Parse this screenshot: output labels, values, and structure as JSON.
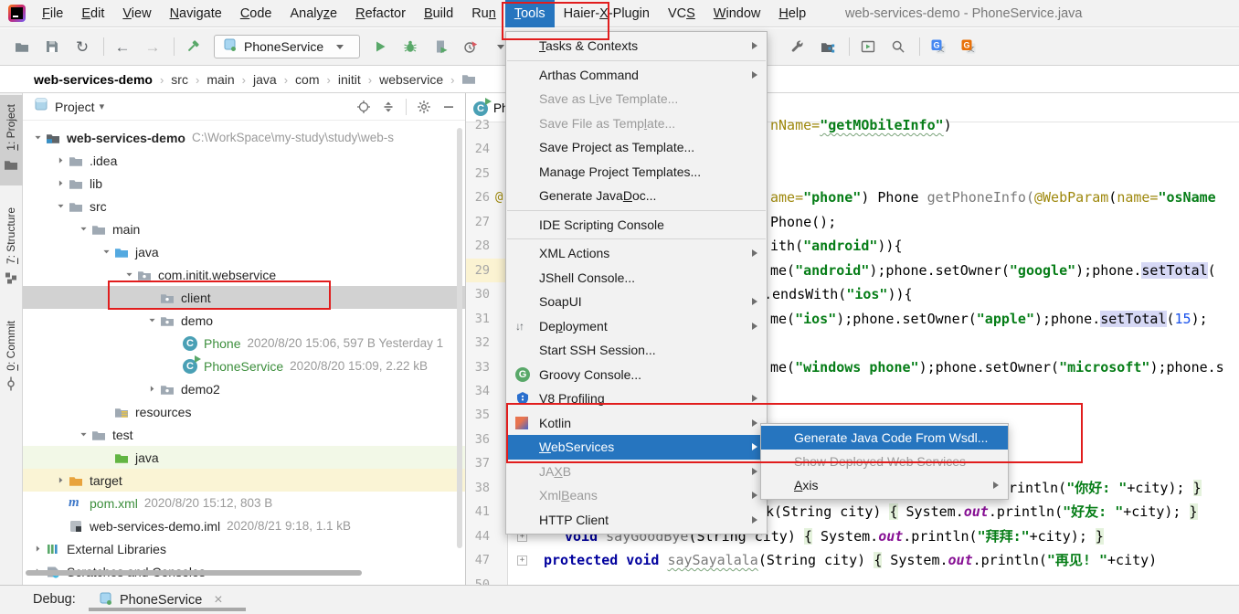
{
  "window": {
    "title": "web-services-demo - PhoneService.java"
  },
  "menubar": {
    "items": [
      {
        "label": "File",
        "u": 0
      },
      {
        "label": "Edit",
        "u": 0
      },
      {
        "label": "View",
        "u": 0
      },
      {
        "label": "Navigate",
        "u": 0
      },
      {
        "label": "Code",
        "u": 0
      },
      {
        "label": "Analyze",
        "u": 5
      },
      {
        "label": "Refactor",
        "u": 0
      },
      {
        "label": "Build",
        "u": 0
      },
      {
        "label": "Run",
        "u": 2
      },
      {
        "label": "Tools",
        "u": 0,
        "active": true
      },
      {
        "label": "Haier-X-Plugin",
        "u": 6
      },
      {
        "label": "VCS",
        "u": 2
      },
      {
        "label": "Window",
        "u": 0
      },
      {
        "label": "Help",
        "u": 0
      }
    ]
  },
  "toolbar": {
    "left_icons": [
      "open",
      "save",
      "sync",
      "|",
      "back",
      "forward",
      "|",
      "hammer"
    ],
    "run_config": {
      "label": "PhoneService",
      "icon": "app"
    },
    "run_icons": [
      "run",
      "debug",
      "coverage",
      "profiler",
      "chevron-down"
    ],
    "right_icons": [
      "wrench",
      "project-structure",
      "|",
      "run-window",
      "search",
      "|",
      "translate-blue",
      "translate-orange"
    ]
  },
  "breadcrumb": {
    "items": [
      "web-services-demo",
      "src",
      "main",
      "java",
      "com",
      "initit",
      "webservice"
    ]
  },
  "tool_stripe": {
    "items": [
      {
        "label": "1: Project",
        "u": 0,
        "icon": "stripe-project",
        "active": true
      },
      {
        "label": "7: Structure",
        "u": 0,
        "icon": "stripe-structure"
      },
      {
        "label": "0: Commit",
        "u": 0,
        "icon": "stripe-commit"
      }
    ]
  },
  "project_panel": {
    "title": "Project",
    "header_icons": [
      "locate",
      "collapse",
      "|",
      "gear",
      "minus"
    ],
    "tree": [
      {
        "label": "web-services-demo",
        "meta": "C:\\WorkSpace\\my-study\\study\\web-s",
        "level": 0,
        "chevron": "open",
        "icon": "project",
        "bold": true
      },
      {
        "label": ".idea",
        "level": 1,
        "chevron": "closed",
        "icon": "folder"
      },
      {
        "label": "lib",
        "level": 1,
        "chevron": "closed",
        "icon": "folder"
      },
      {
        "label": "src",
        "level": 1,
        "chevron": "open",
        "icon": "folder"
      },
      {
        "label": "main",
        "level": 2,
        "chevron": "open",
        "icon": "folder"
      },
      {
        "label": "java",
        "level": 3,
        "chevron": "open",
        "icon": "folder-blue"
      },
      {
        "label": "com.initit.webservice",
        "level": 4,
        "chevron": "open",
        "icon": "package"
      },
      {
        "label": "client",
        "level": 5,
        "chevron": "none",
        "icon": "package",
        "selected": true
      },
      {
        "label": "demo",
        "level": 5,
        "chevron": "open",
        "icon": "package"
      },
      {
        "label": "Phone",
        "meta": "2020/8/20 15:06, 597 B Yesterday 1",
        "level": 6,
        "chevron": "none",
        "icon": "class",
        "green": true
      },
      {
        "label": "PhoneService",
        "meta": "2020/8/20 15:09, 2.22 kB",
        "level": 6,
        "chevron": "none",
        "icon": "class-run",
        "green": true
      },
      {
        "label": "demo2",
        "level": 5,
        "chevron": "closed",
        "icon": "package"
      },
      {
        "label": "resources",
        "level": 3,
        "chevron": "none",
        "icon": "resources"
      },
      {
        "label": "test",
        "level": 2,
        "chevron": "open",
        "icon": "folder"
      },
      {
        "label": "java",
        "level": 3,
        "chevron": "none",
        "icon": "folder-green",
        "row": "green"
      },
      {
        "label": "target",
        "level": 1,
        "chevron": "closed",
        "icon": "folder-orange",
        "row": "yellow"
      },
      {
        "label": "pom.xml",
        "meta": "2020/8/20 15:12, 803 B",
        "level": 1,
        "chevron": "none",
        "icon": "maven",
        "green": true
      },
      {
        "label": "web-services-demo.iml",
        "meta": "2020/8/21 9:18, 1.1 kB",
        "level": 1,
        "chevron": "none",
        "icon": "iml"
      },
      {
        "label": "External Libraries",
        "level": 0,
        "chevron": "closed",
        "icon": "libs"
      },
      {
        "label": "Scratches and Consoles",
        "level": 0,
        "chevron": "closed",
        "icon": "scratch"
      }
    ]
  },
  "editor": {
    "tab": {
      "label": "PhoneService",
      "icon": "class-run"
    },
    "lines": [
      {
        "num": "23",
        "segs": [
          {
            "t": "nName=",
            "c": "o"
          },
          {
            "t": "\"getMObileInfo\"",
            "c": "s wavy"
          },
          {
            "t": ")",
            "c": "d"
          }
        ]
      },
      {
        "num": "24"
      },
      {
        "num": "25"
      },
      {
        "num": "26",
        "ann": "@",
        "segs": [
          {
            "t": "ame=",
            "c": "o"
          },
          {
            "t": "\"phone\"",
            "c": "s"
          },
          {
            "t": ") Phone ",
            "c": "d"
          },
          {
            "t": "getPhoneInfo(",
            "c": "gr"
          },
          {
            "t": "@WebParam",
            "c": "o"
          },
          {
            "t": "(",
            "c": "d"
          },
          {
            "t": "name=",
            "c": "o"
          },
          {
            "t": "\"osName",
            "c": "s"
          }
        ]
      },
      {
        "num": "27",
        "segs": [
          {
            "t": "Phone();",
            "c": "d"
          }
        ]
      },
      {
        "num": "28",
        "segs": [
          {
            "t": "ith(",
            "c": "d"
          },
          {
            "t": "\"android\"",
            "c": "s"
          },
          {
            "t": ")){",
            "c": "d"
          }
        ]
      },
      {
        "num": "29",
        "current": true,
        "segs": [
          {
            "t": "me(",
            "c": "d"
          },
          {
            "t": "\"android\"",
            "c": "s"
          },
          {
            "t": ");phone.setOwner(",
            "c": "d"
          },
          {
            "t": "\"google\"",
            "c": "s"
          },
          {
            "t": ");phone.",
            "c": "d"
          },
          {
            "t": "setTotal",
            "c": "d hl"
          },
          {
            "t": "(",
            "c": "d"
          }
        ]
      },
      {
        "num": "30",
        "segs": [
          {
            "t": ".endsWith(",
            "c": "d"
          },
          {
            "t": "\"ios\"",
            "c": "s"
          },
          {
            "t": ")){",
            "c": "d"
          }
        ]
      },
      {
        "num": "31",
        "segs": [
          {
            "t": "me(",
            "c": "d"
          },
          {
            "t": "\"ios\"",
            "c": "s"
          },
          {
            "t": ");phone.setOwner(",
            "c": "d"
          },
          {
            "t": "\"apple\"",
            "c": "s"
          },
          {
            "t": ");phone.",
            "c": "d"
          },
          {
            "t": "setTotal",
            "c": "d hl"
          },
          {
            "t": "(",
            "c": "d"
          },
          {
            "t": "15",
            "c": "n"
          },
          {
            "t": ");",
            "c": "d"
          }
        ]
      },
      {
        "num": "32"
      },
      {
        "num": "33",
        "segs": [
          {
            "t": "me(",
            "c": "d"
          },
          {
            "t": "\"windows phone\"",
            "c": "s"
          },
          {
            "t": ");phone.setOwner(",
            "c": "d"
          },
          {
            "t": "\"microsoft\"",
            "c": "s"
          },
          {
            "t": ");phone.s",
            "c": "d"
          }
        ]
      },
      {
        "num": "34"
      },
      {
        "num": "35"
      },
      {
        "num": "36"
      },
      {
        "num": "37"
      },
      {
        "num": "38",
        "segs": [
          {
            "t": "rintln(",
            "c": "d"
          },
          {
            "t": "\"你好: \"",
            "c": "s"
          },
          {
            "t": "+city); ",
            "c": "d"
          },
          {
            "t": "}",
            "c": "d bb"
          }
        ]
      },
      {
        "num": "41",
        "segs": [
          {
            "t": "k(String city) ",
            "c": "d"
          },
          {
            "t": "{",
            "c": "d bb"
          },
          {
            "t": " System.",
            "c": "d"
          },
          {
            "t": "out",
            "c": "f"
          },
          {
            "t": ".println(",
            "c": "d"
          },
          {
            "t": "\"好友: \"",
            "c": "s"
          },
          {
            "t": "+city); ",
            "c": "d"
          },
          {
            "t": "}",
            "c": "d bb"
          }
        ]
      },
      {
        "num": "44",
        "fold": true,
        "segs": [
          {
            "t": "void ",
            "c": "k"
          },
          {
            "t": "sayGoodBye",
            "c": "gr"
          },
          {
            "t": "(String city) ",
            "c": "d"
          },
          {
            "t": "{",
            "c": "d bb"
          },
          {
            "t": " System.",
            "c": "d"
          },
          {
            "t": "out",
            "c": "f"
          },
          {
            "t": ".println(",
            "c": "d"
          },
          {
            "t": "\"拜拜:\"",
            "c": "s"
          },
          {
            "t": "+city); ",
            "c": "d"
          },
          {
            "t": "}",
            "c": "d bb"
          }
        ]
      },
      {
        "num": "47",
        "fold": true,
        "segs": [
          {
            "t": "protected void ",
            "c": "k"
          },
          {
            "t": "saySayalala",
            "c": "gr wavy"
          },
          {
            "t": "(String city) ",
            "c": "d"
          },
          {
            "t": "{",
            "c": "d bb"
          },
          {
            "t": " System.",
            "c": "d"
          },
          {
            "t": "out",
            "c": "f"
          },
          {
            "t": ".println(",
            "c": "d"
          },
          {
            "t": "\"再见! \"",
            "c": "s"
          },
          {
            "t": "+city)",
            "c": "d"
          }
        ]
      },
      {
        "num": "50"
      }
    ]
  },
  "tools_menu": {
    "items": [
      {
        "label": "Tasks & Contexts",
        "u": 0,
        "arrow": true
      },
      {
        "sep": true
      },
      {
        "label": "Arthas Command",
        "arrow": true
      },
      {
        "label": "Save as Live Template...",
        "u": 9,
        "disabled": true
      },
      {
        "label": "Save File as Template...",
        "u": 17,
        "disabled": true
      },
      {
        "label": "Save Project as Template..."
      },
      {
        "label": "Manage Project Templates..."
      },
      {
        "label": "Generate JavaDoc...",
        "u": 13
      },
      {
        "sep": true
      },
      {
        "label": "IDE Scripting Console"
      },
      {
        "sep": true
      },
      {
        "label": "XML Actions",
        "arrow": true
      },
      {
        "label": "JShell Console..."
      },
      {
        "label": "SoapUI",
        "arrow": true
      },
      {
        "label": "Deployment",
        "u": 2,
        "icon": "deploy",
        "arrow": true
      },
      {
        "label": "Start SSH Session..."
      },
      {
        "label": "Groovy Console...",
        "icon": "groovy"
      },
      {
        "label": "V8 Profiling",
        "u": 1,
        "icon": "v8",
        "arrow": true
      },
      {
        "label": "Kotlin",
        "icon": "kotlin",
        "arrow": true
      },
      {
        "label": "WebServices",
        "u": 0,
        "selected": true,
        "arrow": true
      },
      {
        "label": "JAXB",
        "u": 2,
        "disabled": true,
        "arrow": true
      },
      {
        "label": "XmlBeans",
        "u": 3,
        "disabled": true,
        "arrow": true
      },
      {
        "label": "HTTP Client",
        "arrow": true
      }
    ]
  },
  "webservices_submenu": {
    "items": [
      {
        "label": "Generate Java Code From Wsdl...",
        "selected": true
      },
      {
        "label": "Show Deployed Web Services",
        "disabled": true
      },
      {
        "label": "Axis",
        "u": 0,
        "arrow": true
      }
    ]
  },
  "debug_bar": {
    "label": "Debug:",
    "tab": {
      "label": "PhoneService",
      "icon": "app"
    }
  },
  "colors": {
    "accent": "#2675bf",
    "annotation_red": "#e11d1d",
    "selection_gray": "#d2d2d2",
    "string_green": "#067d17",
    "keyword_navy": "#00009e",
    "file_green": "#3d8f3d"
  }
}
